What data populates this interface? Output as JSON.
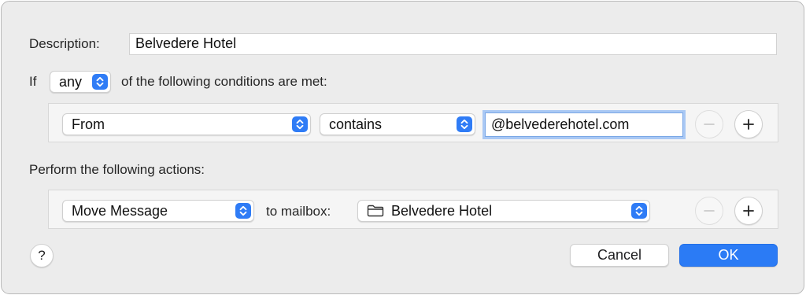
{
  "dialog": {
    "description_label": "Description:",
    "description_value": "Belvedere Hotel",
    "if_label": "If",
    "match_mode": "any",
    "conditions_suffix": "of the following conditions are met:",
    "conditions": [
      {
        "field": "From",
        "operator": "contains",
        "value": "@belvederehotel.com",
        "remove_icon": "minus-icon",
        "add_icon": "plus-icon"
      }
    ],
    "actions_label": "Perform the following actions:",
    "actions": [
      {
        "action": "Move Message",
        "target_label": "to mailbox:",
        "mailbox_icon": "folder-icon",
        "mailbox": "Belvedere Hotel",
        "remove_icon": "minus-icon",
        "add_icon": "plus-icon"
      }
    ],
    "help_label": "?",
    "cancel_label": "Cancel",
    "ok_label": "OK"
  },
  "colors": {
    "accent": "#2b7bf5",
    "focus_ring": "#a9c8f4",
    "sheet_background": "#ececec"
  }
}
